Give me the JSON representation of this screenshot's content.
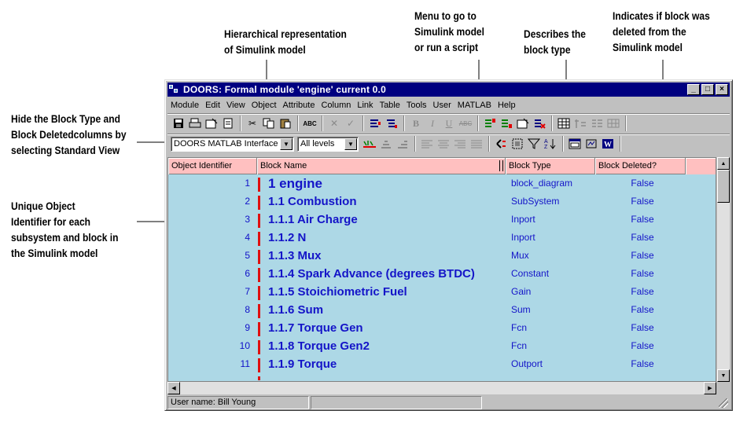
{
  "annotations": {
    "hierarchical": [
      "Hierarchical representation",
      "of Simulink model"
    ],
    "menu": [
      "Menu to go to",
      "Simulink  model",
      "or run a script"
    ],
    "describes": [
      "Describes the",
      "block type"
    ],
    "indicates": [
      "Indicates if block was",
      "deleted from the",
      "Simulink model"
    ],
    "hide": {
      "line1_a": "Hide the ",
      "line1_b": "Block Type",
      "line1_c": " and",
      "line2_a": "Block Deleted",
      "line2_b": "columns by",
      "line3_a": "selecting ",
      "line3_b": "Standard View"
    },
    "unique": [
      "Unique Object",
      "Identifier for each",
      "subsystem and block in",
      "the Simulink model"
    ]
  },
  "window": {
    "title": "DOORS: Formal module 'engine' current 0.0",
    "controls": {
      "minimize": "_",
      "maximize": "□",
      "close": "×"
    }
  },
  "menus": [
    "Module",
    "Edit",
    "View",
    "Object",
    "Attribute",
    "Column",
    "Link",
    "Table",
    "Tools",
    "User",
    "MATLAB",
    "Help"
  ],
  "toolbar2": {
    "view_select": "DOORS MATLAB Interface",
    "level_select": "All levels"
  },
  "table": {
    "headers": [
      "Object Identifier",
      "Block Name",
      "Block Type",
      "Block Deleted?"
    ],
    "rows": [
      {
        "id": "1",
        "name": "1 engine",
        "type": "block_diagram",
        "deleted": "False"
      },
      {
        "id": "2",
        "name": "1.1 Combustion",
        "type": "SubSystem",
        "deleted": "False"
      },
      {
        "id": "3",
        "name": "1.1.1 Air Charge",
        "type": "Inport",
        "deleted": "False"
      },
      {
        "id": "4",
        "name": "1.1.2 N",
        "type": "Inport",
        "deleted": "False"
      },
      {
        "id": "5",
        "name": "1.1.3 Mux",
        "type": "Mux",
        "deleted": "False"
      },
      {
        "id": "6",
        "name": "1.1.4 Spark Advance (degrees BTDC)",
        "type": "Constant",
        "deleted": "False"
      },
      {
        "id": "7",
        "name": "1.1.5 Stoichiometric Fuel",
        "type": "Gain",
        "deleted": "False"
      },
      {
        "id": "8",
        "name": "1.1.6 Sum",
        "type": "Sum",
        "deleted": "False"
      },
      {
        "id": "9",
        "name": "1.1.7 Torque Gen",
        "type": "Fcn",
        "deleted": "False"
      },
      {
        "id": "10",
        "name": "1.1.8 Torque Gen2",
        "type": "Fcn",
        "deleted": "False"
      },
      {
        "id": "11",
        "name": "1.1.9 Torque",
        "type": "Outport",
        "deleted": "False"
      }
    ]
  },
  "status": {
    "user": "User name: Bill Young"
  },
  "colors": {
    "title_bar": "#000080",
    "header_bg": "#ffc0c0",
    "row_bg": "#add8e6",
    "text_blue": "#1414c8",
    "level_bar": "#e01010"
  }
}
